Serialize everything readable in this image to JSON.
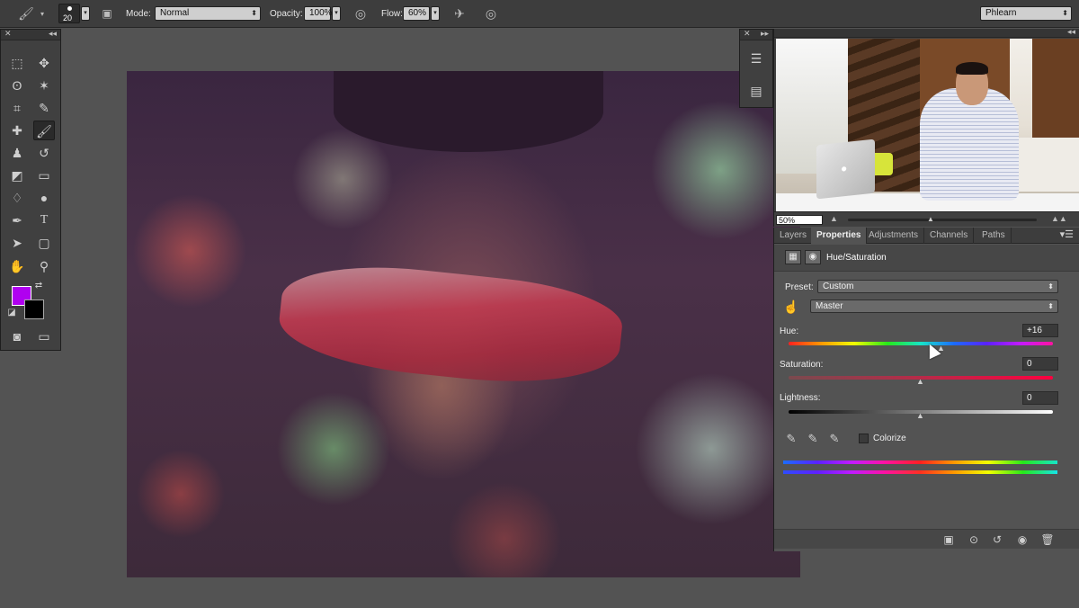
{
  "options_bar": {
    "brush_size": "20",
    "mode_label": "Mode:",
    "mode_value": "Normal",
    "opacity_label": "Opacity:",
    "opacity_value": "100%",
    "flow_label": "Flow:",
    "flow_value": "60%",
    "workspace": "Phlearn"
  },
  "navigator": {
    "zoom": "50%"
  },
  "properties": {
    "tabs": [
      {
        "label": "Layers",
        "active": false
      },
      {
        "label": "Properties",
        "active": true
      },
      {
        "label": "Adjustments",
        "active": false
      },
      {
        "label": "Channels",
        "active": false
      },
      {
        "label": "Paths",
        "active": false
      }
    ],
    "title": "Hue/Saturation",
    "preset_label": "Preset:",
    "preset_value": "Custom",
    "channel_value": "Master",
    "hue_label": "Hue:",
    "hue_value": "+16",
    "saturation_label": "Saturation:",
    "saturation_value": "0",
    "lightness_label": "Lightness:",
    "lightness_value": "0",
    "colorize_label": "Colorize",
    "colorize_checked": false
  },
  "colors": {
    "foreground": "#b000f0",
    "background": "#000000",
    "ui_dark": "#3d3d3d",
    "ui_panel": "#535353"
  },
  "icons": {
    "options_bar": [
      "brush-icon",
      "brush-panel-icon",
      "pressure-opacity-icon",
      "airbrush-icon",
      "pressure-size-icon"
    ],
    "tools": [
      "marquee-icon",
      "move-icon",
      "lasso-icon",
      "magic-wand-icon",
      "crop-icon",
      "eyedropper-icon",
      "healing-icon",
      "brush-icon",
      "stamp-icon",
      "history-brush-icon",
      "eraser-icon",
      "gradient-icon",
      "blur-icon",
      "dodge-icon",
      "pen-icon",
      "type-icon",
      "path-select-icon",
      "rectangle-icon",
      "hand-icon",
      "zoom-icon",
      "quick-mask-icon",
      "screen-mode-icon"
    ]
  }
}
